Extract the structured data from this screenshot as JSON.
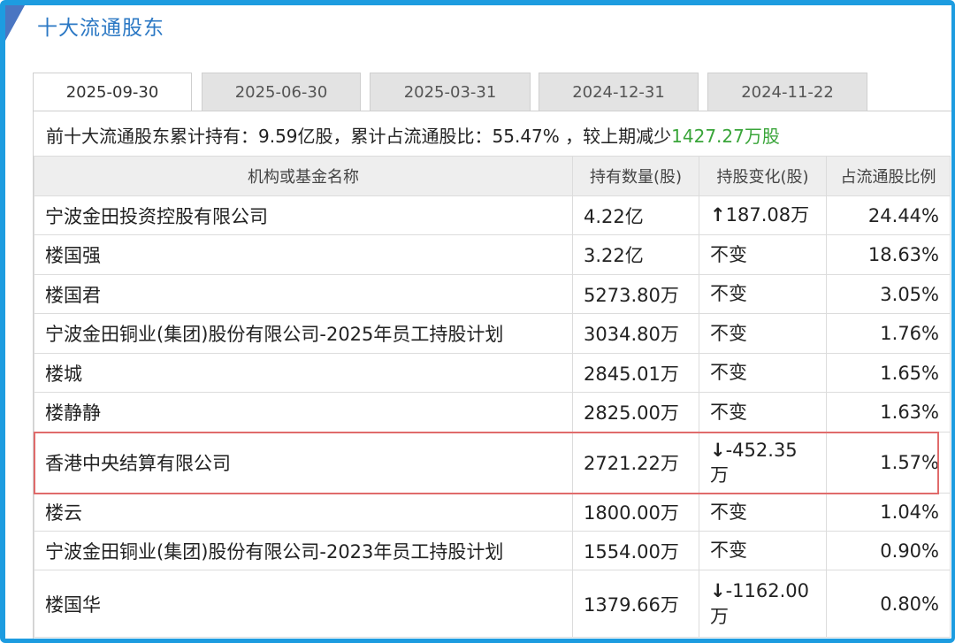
{
  "header": {
    "title": "十大流通股东"
  },
  "tabs": [
    {
      "label": "2025-09-30",
      "active": true
    },
    {
      "label": "2025-06-30",
      "active": false
    },
    {
      "label": "2025-03-31",
      "active": false
    },
    {
      "label": "2024-12-31",
      "active": false
    },
    {
      "label": "2024-11-22",
      "active": false
    }
  ],
  "summary": {
    "text": "前十大流通股东累计持有：9.59亿股，累计占流通股比：55.47% ，较上期减少",
    "change": "1427.27万股"
  },
  "table": {
    "columns": [
      "机构或基金名称",
      "持有数量(股)",
      "持股变化(股)",
      "占流通股比例"
    ],
    "rows": [
      {
        "name": "宁波金田投资控股有限公司",
        "shares": "4.22亿",
        "change": "187.08万",
        "direction": "up",
        "ratio": "24.44%"
      },
      {
        "name": "楼国强",
        "shares": "3.22亿",
        "change": "不变",
        "direction": "none",
        "ratio": "18.63%"
      },
      {
        "name": "楼国君",
        "shares": "5273.80万",
        "change": "不变",
        "direction": "none",
        "ratio": "3.05%"
      },
      {
        "name": "宁波金田铜业(集团)股份有限公司-2025年员工持股计划",
        "shares": "3034.80万",
        "change": "不变",
        "direction": "none",
        "ratio": "1.76%"
      },
      {
        "name": "楼城",
        "shares": "2845.01万",
        "change": "不变",
        "direction": "none",
        "ratio": "1.65%"
      },
      {
        "name": "楼静静",
        "shares": "2825.00万",
        "change": "不变",
        "direction": "none",
        "ratio": "1.63%"
      },
      {
        "name": "香港中央结算有限公司",
        "shares": "2721.22万",
        "change": "-452.35万",
        "direction": "down",
        "ratio": "1.57%"
      },
      {
        "name": "楼云",
        "shares": "1800.00万",
        "change": "不变",
        "direction": "none",
        "ratio": "1.04%"
      },
      {
        "name": "宁波金田铜业(集团)股份有限公司-2023年员工持股计划",
        "shares": "1554.00万",
        "change": "不变",
        "direction": "none",
        "ratio": "0.90%"
      },
      {
        "name": "楼国华",
        "shares": "1379.66万",
        "change": "-1162.00万",
        "direction": "down",
        "ratio": "0.80%"
      }
    ]
  },
  "colors": {
    "frame": "#1d9ce0",
    "title": "#2b78c4",
    "up": "#d8261c",
    "down": "#3aa53a",
    "highlight": "#e06b6b"
  }
}
